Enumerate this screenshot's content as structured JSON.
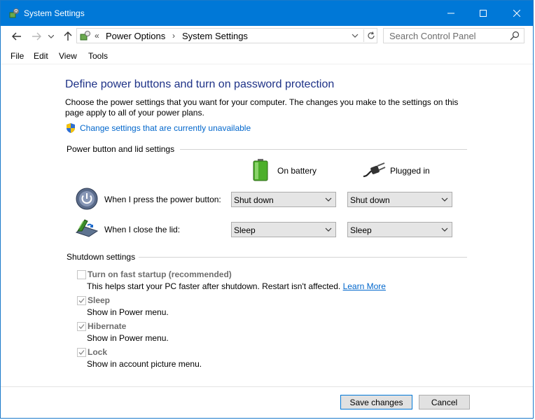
{
  "window": {
    "title": "System Settings"
  },
  "address": {
    "breadcrumb_prefix": "«",
    "crumbs": [
      "Power Options",
      "System Settings"
    ],
    "separator": "›"
  },
  "search": {
    "placeholder": "Search Control Panel"
  },
  "menu": [
    "File",
    "Edit",
    "View",
    "Tools"
  ],
  "page": {
    "title": "Define power buttons and turn on password protection",
    "description": "Choose the power settings that you want for your computer. The changes you make to the settings on this page apply to all of your power plans.",
    "change_link": "Change settings that are currently unavailable"
  },
  "power_section": {
    "label": "Power button and lid settings",
    "columns": {
      "battery": "On battery",
      "plugged": "Plugged in"
    },
    "rows": [
      {
        "label": "When I press the power button:",
        "battery": "Shut down",
        "plugged": "Shut down"
      },
      {
        "label": "When I close the lid:",
        "battery": "Sleep",
        "plugged": "Sleep"
      }
    ]
  },
  "shutdown_section": {
    "label": "Shutdown settings",
    "items": [
      {
        "label": "Turn on fast startup (recommended)",
        "desc": "This helps start your PC faster after shutdown. Restart isn't affected.",
        "link": "Learn More",
        "checked": false
      },
      {
        "label": "Sleep",
        "desc": "Show in Power menu.",
        "checked": true
      },
      {
        "label": "Hibernate",
        "desc": "Show in Power menu.",
        "checked": true
      },
      {
        "label": "Lock",
        "desc": "Show in account picture menu.",
        "checked": true
      }
    ]
  },
  "buttons": {
    "save": "Save changes",
    "cancel": "Cancel"
  },
  "colors": {
    "titlebar": "#0078d7",
    "heading": "#1e3287",
    "link": "#0066cc"
  }
}
